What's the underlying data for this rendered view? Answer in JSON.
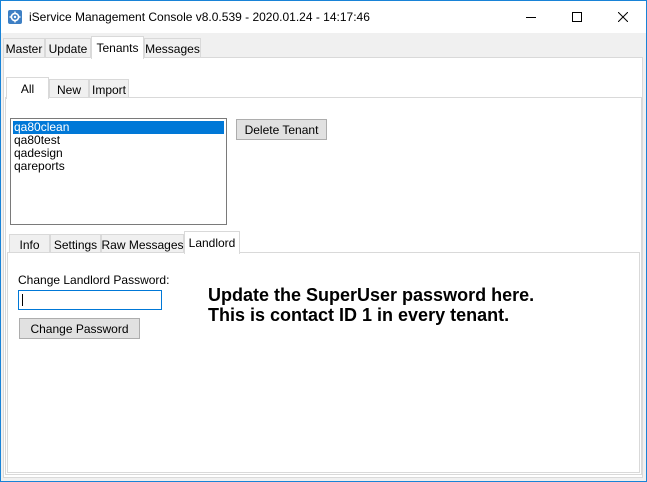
{
  "window": {
    "title": "iService Management Console v8.0.539 - 2020.01.24 - 14:17:46",
    "icon": "gear-app-icon"
  },
  "top_tabs": [
    {
      "label": "Master",
      "selected": false
    },
    {
      "label": "Update",
      "selected": false
    },
    {
      "label": "Tenants",
      "selected": true
    },
    {
      "label": "Messages",
      "selected": false
    }
  ],
  "tenant_tabs": [
    {
      "label": "All",
      "selected": true
    },
    {
      "label": "New",
      "selected": false
    },
    {
      "label": "Import",
      "selected": false
    }
  ],
  "tenants": {
    "items": [
      "qa80clean",
      "qa80test",
      "qadesign",
      "qareports"
    ],
    "selected_index": 0,
    "delete_label": "Delete Tenant"
  },
  "detail_tabs": [
    {
      "label": "Info",
      "selected": false
    },
    {
      "label": "Settings",
      "selected": false
    },
    {
      "label": "Raw Messages",
      "selected": false
    },
    {
      "label": "Landlord",
      "selected": true
    }
  ],
  "landlord": {
    "password_label": "Change Landlord Password:",
    "password_value": "",
    "change_button": "Change Password"
  },
  "annotation": {
    "line1": "Update the SuperUser password here.",
    "line2": "This is contact ID 1 in every tenant."
  },
  "colors": {
    "selection": "#0078d7",
    "window_border": "#1883d7"
  }
}
